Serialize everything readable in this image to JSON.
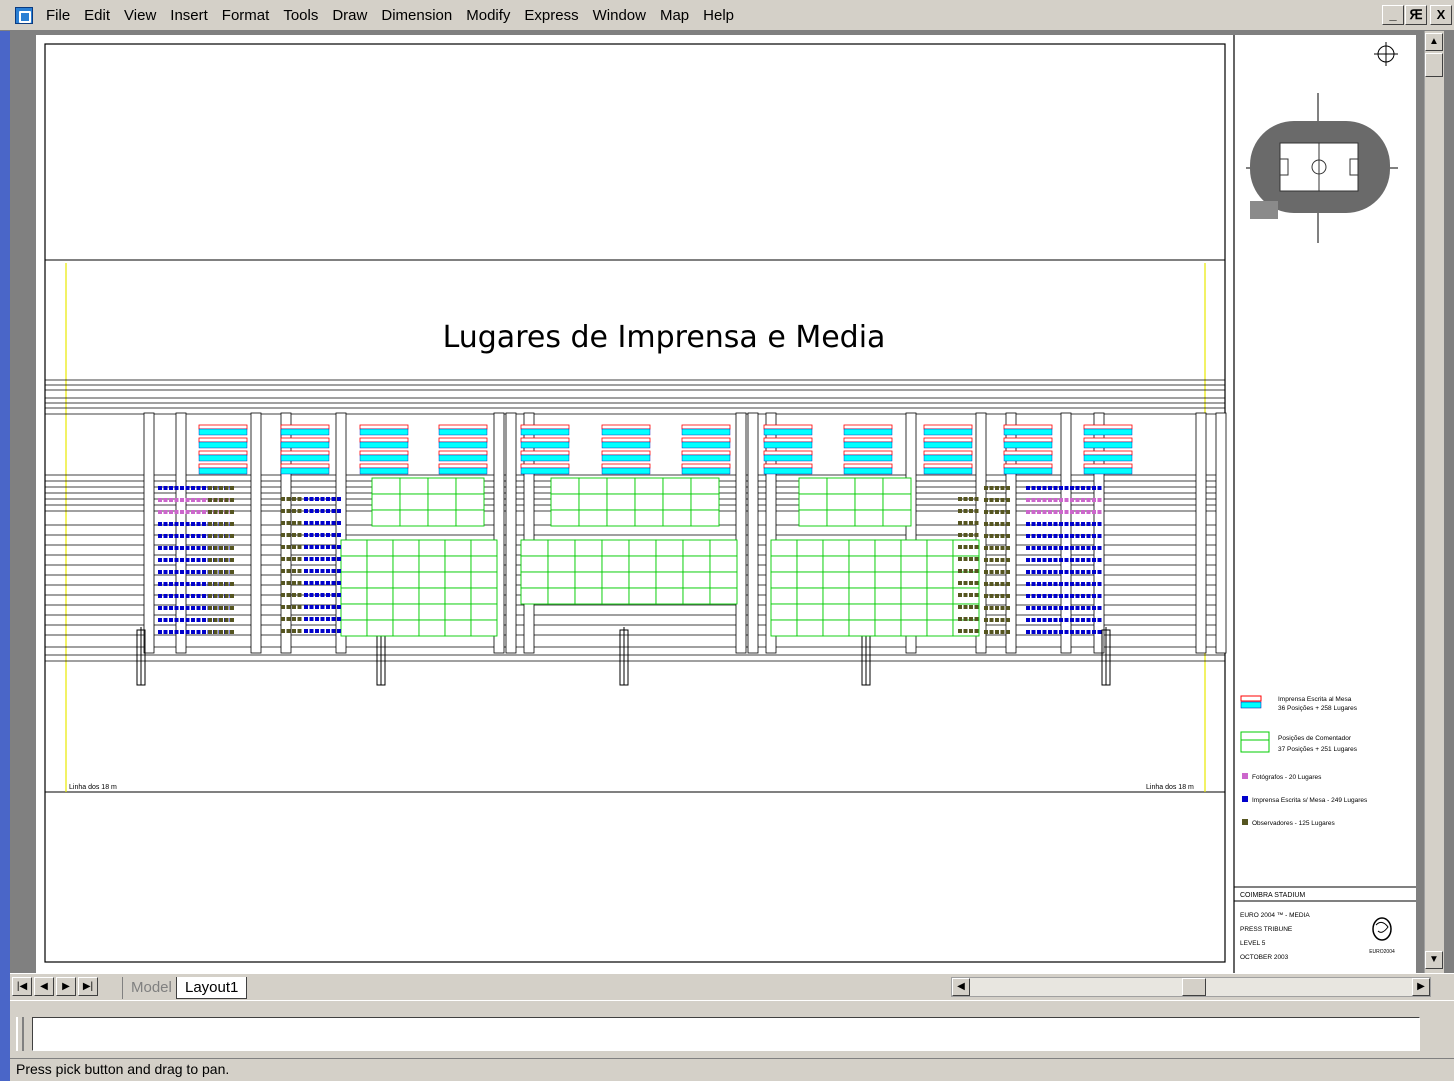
{
  "menu": {
    "items": [
      "File",
      "Edit",
      "View",
      "Insert",
      "Format",
      "Tools",
      "Draw",
      "Dimension",
      "Modify",
      "Express",
      "Window",
      "Map",
      "Help"
    ]
  },
  "window_controls": {
    "minimize": "_",
    "restore": "Ԙ",
    "close": "X"
  },
  "drawing": {
    "title": "Lugares de Imprensa e Media",
    "linha_left": "Linha dos 18 m",
    "linha_right": "Linha dos 18 m"
  },
  "legend": {
    "items": [
      {
        "line1": "Imprensa Escrita al Mesa",
        "line2": "36 Posições + 258 Lugares",
        "color": "#ff0000",
        "color2": "#00ffff"
      },
      {
        "line1": "Posições de Comentador",
        "line2": "37 Posições + 251 Lugares",
        "color": "#00dd00"
      },
      {
        "line1": "Fotógrafos - 20 Lugares",
        "color": "#cc66cc"
      },
      {
        "line1": "Imprensa Escrita s/ Mesa - 249 Lugares",
        "color": "#0000cc"
      },
      {
        "line1": "Observadores - 125 Lugares",
        "color": "#555520"
      }
    ]
  },
  "title_block": {
    "stadium": "COIMBRA STADIUM",
    "lines": [
      "EURO 2004 ™ - MEDIA",
      "PRESS TRIBUNE",
      "LEVEL 5",
      "OCTOBER 2003"
    ],
    "logo": "EURO2004"
  },
  "tabs": {
    "model": "Model",
    "layout1": "Layout1"
  },
  "command": {
    "value": ""
  },
  "status": {
    "text": "Press pick button and drag to pan."
  }
}
